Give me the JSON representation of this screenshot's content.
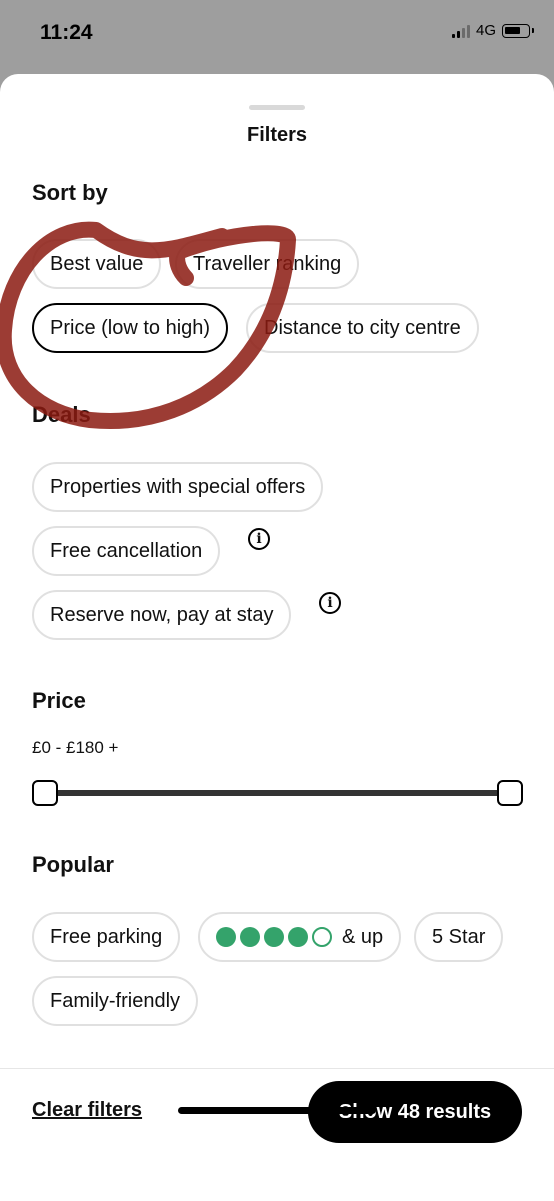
{
  "status_bar": {
    "time": "11:24",
    "network": "4G"
  },
  "sheet": {
    "title": "Filters"
  },
  "sort": {
    "heading": "Sort by",
    "options": [
      "Best value",
      "Traveller ranking",
      "Price (low to high)",
      "Distance to city centre"
    ],
    "selected": "Price (low to high)"
  },
  "deals": {
    "heading": "Deals",
    "options": [
      "Properties with special offers",
      "Free cancellation",
      "Reserve now, pay at stay"
    ]
  },
  "price": {
    "heading": "Price",
    "range_label": "£0 - £180 +",
    "min_fraction": 0,
    "max_fraction": 1
  },
  "popular": {
    "heading": "Popular",
    "options": [
      "Free parking",
      "& up",
      "5 Star",
      "Family-friendly"
    ],
    "rating_bubbles_filled": 4,
    "rating_bubbles_total": 5
  },
  "footer": {
    "clear_label": "Clear filters",
    "show_label": "Show 48 results"
  },
  "colors": {
    "rating_green": "#34a36b",
    "annotation_red": "#8b1a10"
  }
}
